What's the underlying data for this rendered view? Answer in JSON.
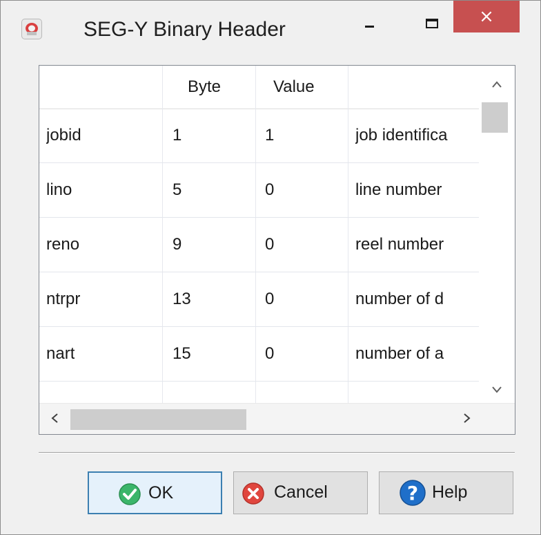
{
  "window": {
    "title": "SEG-Y Binary Header",
    "close_glyph": "×"
  },
  "table": {
    "columns": [
      "",
      "Byte",
      "Value",
      ""
    ],
    "rows": [
      {
        "name": "jobid",
        "byte": "1",
        "value": "1",
        "desc": "job identifica"
      },
      {
        "name": "lino",
        "byte": "5",
        "value": "0",
        "desc": "line number"
      },
      {
        "name": "reno",
        "byte": "9",
        "value": "0",
        "desc": "reel number"
      },
      {
        "name": "ntrpr",
        "byte": "13",
        "value": "0",
        "desc": "number of d"
      },
      {
        "name": "nart",
        "byte": "15",
        "value": "0",
        "desc": "number of a"
      }
    ]
  },
  "scroll": {
    "up": "^",
    "down": "v",
    "left": "<",
    "right": ">"
  },
  "buttons": {
    "ok": "OK",
    "cancel": "Cancel",
    "help": "Help"
  },
  "icons": {
    "app": "seismic-app-icon",
    "ok": "green-check-icon",
    "cancel": "red-x-icon",
    "help": "blue-question-icon"
  },
  "colors": {
    "close": "#c75050",
    "ok": "#3bb56a",
    "cancel": "#e0463e",
    "help": "#1f6fc9",
    "focus": "#3c7fb1"
  }
}
